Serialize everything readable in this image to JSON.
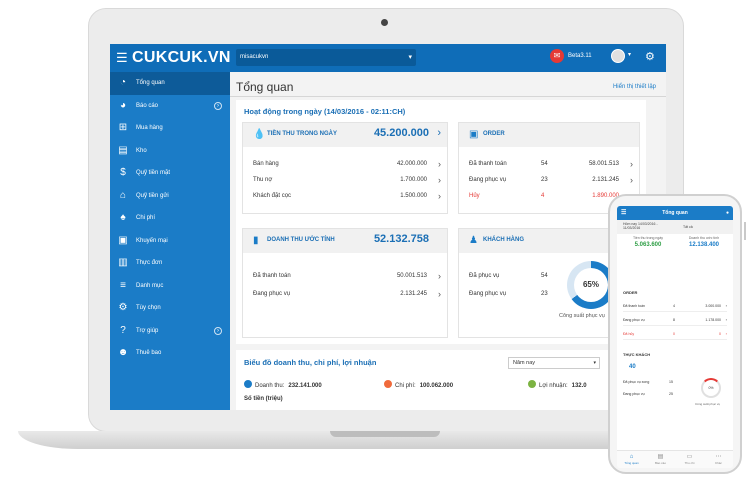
{
  "topbar": {
    "menu_icon": "hamburger-icon",
    "logo": "CUKCUK.VN",
    "branch": "misacukvn",
    "username": "Beta3.11",
    "chat_icon": "chat-icon",
    "settings_icon": "settings-icon"
  },
  "sidebar": {
    "items": [
      {
        "label": "Tổng quan",
        "icon": "dashboard-icon"
      },
      {
        "label": "Báo cáo",
        "icon": "pie-chart-icon"
      },
      {
        "label": "Mua hàng",
        "icon": "cart-icon"
      },
      {
        "label": "Kho",
        "icon": "warehouse-icon"
      },
      {
        "label": "Quỹ tiền mặt",
        "icon": "dollar-icon"
      },
      {
        "label": "Quỹ tiền gửi",
        "icon": "bank-icon"
      },
      {
        "label": "Chi phí",
        "icon": "expense-icon"
      },
      {
        "label": "Khuyến mại",
        "icon": "gift-icon"
      },
      {
        "label": "Thực đơn",
        "icon": "menu-book-icon"
      },
      {
        "label": "Danh mục",
        "icon": "list-icon"
      },
      {
        "label": "Tùy chọn",
        "icon": "gear-icon"
      },
      {
        "label": "Trợ giúp",
        "icon": "help-icon"
      },
      {
        "label": "Thuê bao",
        "icon": "users-icon"
      }
    ]
  },
  "main": {
    "title": "Tổng quan",
    "customize_link": "Hiển thị thiết lập",
    "activity_title": "Hoạt động trong ngày (14/03/2016 - 02:11:CH)",
    "revenue_today": {
      "title": "TIỀN THU TRONG NGÀY",
      "value": "45.200.000",
      "rows": [
        {
          "label": "Bán hàng",
          "value": "42.000.000"
        },
        {
          "label": "Thu nợ",
          "value": "1.700.000"
        },
        {
          "label": "Khách đặt cọc",
          "value": "1.500.000"
        }
      ]
    },
    "order": {
      "title": "ORDER",
      "rows": [
        {
          "label": "Đã thanh toán",
          "count": "54",
          "value": "58.001.513"
        },
        {
          "label": "Đang phục vụ",
          "count": "23",
          "value": "2.131.245"
        },
        {
          "label": "Hủy",
          "count": "4",
          "value": "1.890.000"
        }
      ]
    },
    "estimated_revenue": {
      "title": "DOANH THU ƯỚC TÍNH",
      "value": "52.132.758",
      "rows": [
        {
          "label": "Đã thanh toán",
          "value": "50.001.513"
        },
        {
          "label": "Đang phục vụ",
          "value": "2.131.245"
        }
      ]
    },
    "customers": {
      "title": "KHÁCH HÀNG",
      "rows": [
        {
          "label": "Đã phục vụ",
          "count": "54"
        },
        {
          "label": "Đang phục vụ",
          "count": "23"
        }
      ],
      "donut_percent": 65,
      "donut_label": "65%",
      "donut_caption": "Công suất phục vụ"
    },
    "chart": {
      "title": "Biểu đồ doanh thu, chi phí, lợi nhuận",
      "period": "Năm nay",
      "legend": [
        {
          "label": "Doanh thu:",
          "value": "232.141.000",
          "color": "#1b7cc7"
        },
        {
          "label": "Chi phí:",
          "value": "100.062.000",
          "color": "#f06a3b"
        },
        {
          "label": "Lợi nhuận:",
          "value": "132.0",
          "color": "#7cb342"
        }
      ],
      "unit": "Số tiền (triệu)"
    }
  },
  "phone": {
    "title": "Tổng quan",
    "filter_left": "Hôm nay 14/03/2016 - 11/03/2016",
    "filter_right": "Tất cả",
    "stat_left_label": "Tiền thu trong ngày",
    "stat_left_value": "5.063.600",
    "stat_right_label": "Doanh thu ước tính",
    "stat_right_value": "12.138.400",
    "order_section": "ORDER",
    "order_rows": [
      {
        "label": "Đã thanh toán",
        "count": "4",
        "value": "3.000.000"
      },
      {
        "label": "Đang phục vụ",
        "count": "8",
        "value": "1.178.000"
      },
      {
        "label": "Đã hủy",
        "count": "0",
        "value": "0"
      }
    ],
    "customer_section": "THỰC KHÁCH",
    "customer_total": "40",
    "customer_rows": [
      {
        "label": "Đã phục vụ xong",
        "count": "15"
      },
      {
        "label": "Đang phục vụ",
        "count": "25"
      }
    ],
    "donut_label": "0%",
    "donut_caption": "Công suất phục vụ",
    "tabs": [
      {
        "label": "Tổng quan",
        "icon": "home-icon"
      },
      {
        "label": "Báo cáo",
        "icon": "report-icon"
      },
      {
        "label": "Thu chi",
        "icon": "wallet-icon"
      },
      {
        "label": "Khác",
        "icon": "more-icon"
      }
    ]
  }
}
